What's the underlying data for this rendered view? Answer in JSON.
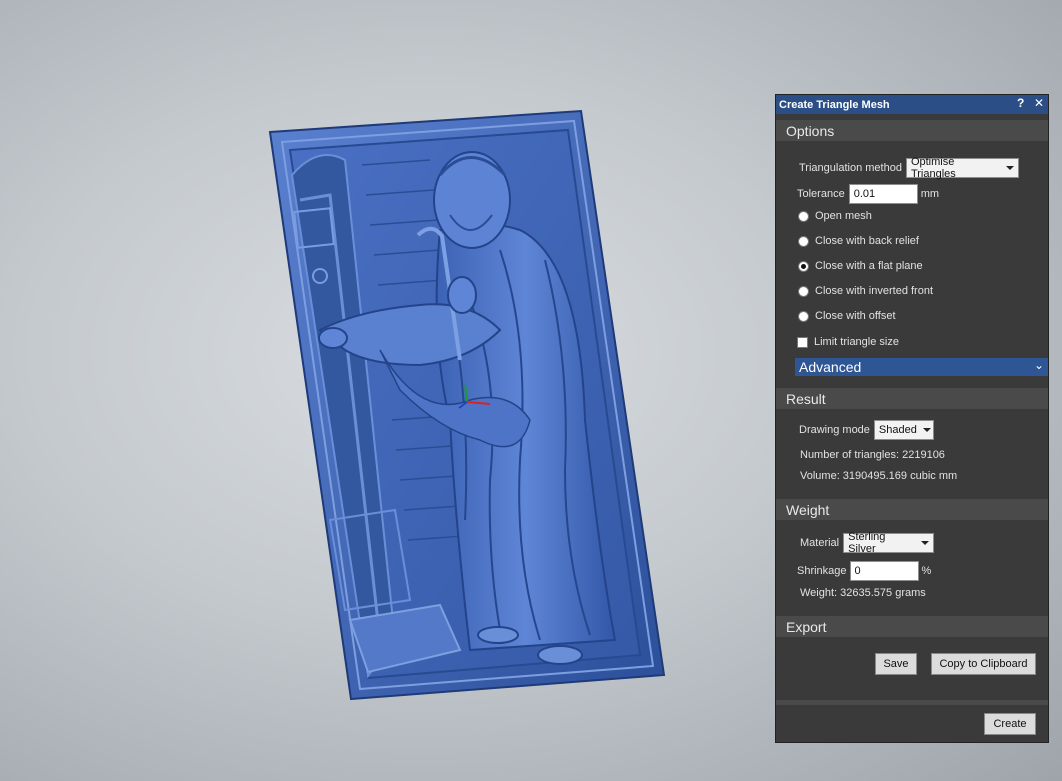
{
  "dialog": {
    "title": "Create Triangle Mesh",
    "help": "?",
    "close": "✕"
  },
  "options": {
    "header": "Options",
    "triangulation_label": "Triangulation method",
    "triangulation_value": "Optimise Triangles",
    "tolerance_label": "Tolerance",
    "tolerance_value": "0.01",
    "tolerance_unit": "mm",
    "radios": [
      {
        "label": "Open mesh",
        "selected": false
      },
      {
        "label": "Close with back relief",
        "selected": false
      },
      {
        "label": "Close with a flat plane",
        "selected": true
      },
      {
        "label": "Close with inverted front",
        "selected": false
      },
      {
        "label": "Close with offset",
        "selected": false
      }
    ],
    "limit_label": "Limit triangle size",
    "limit_checked": false,
    "advanced_label": "Advanced"
  },
  "result": {
    "header": "Result",
    "drawing_mode_label": "Drawing mode",
    "drawing_mode_value": "Shaded",
    "triangles_text": "Number of triangles: 2219106",
    "volume_text": "Volume: 3190495.169 cubic mm"
  },
  "weight": {
    "header": "Weight",
    "material_label": "Material",
    "material_value": "Sterling Silver",
    "shrinkage_label": "Shrinkage",
    "shrinkage_value": "0",
    "shrinkage_unit": "%",
    "weight_text": "Weight: 32635.575 grams"
  },
  "export": {
    "header": "Export",
    "save_label": "Save",
    "clipboard_label": "Copy to Clipboard"
  },
  "create_label": "Create",
  "colors": {
    "relief_blue": "#3f66b8",
    "title_bar": "#2a4e85",
    "panel_bg": "#3a3a3a"
  }
}
